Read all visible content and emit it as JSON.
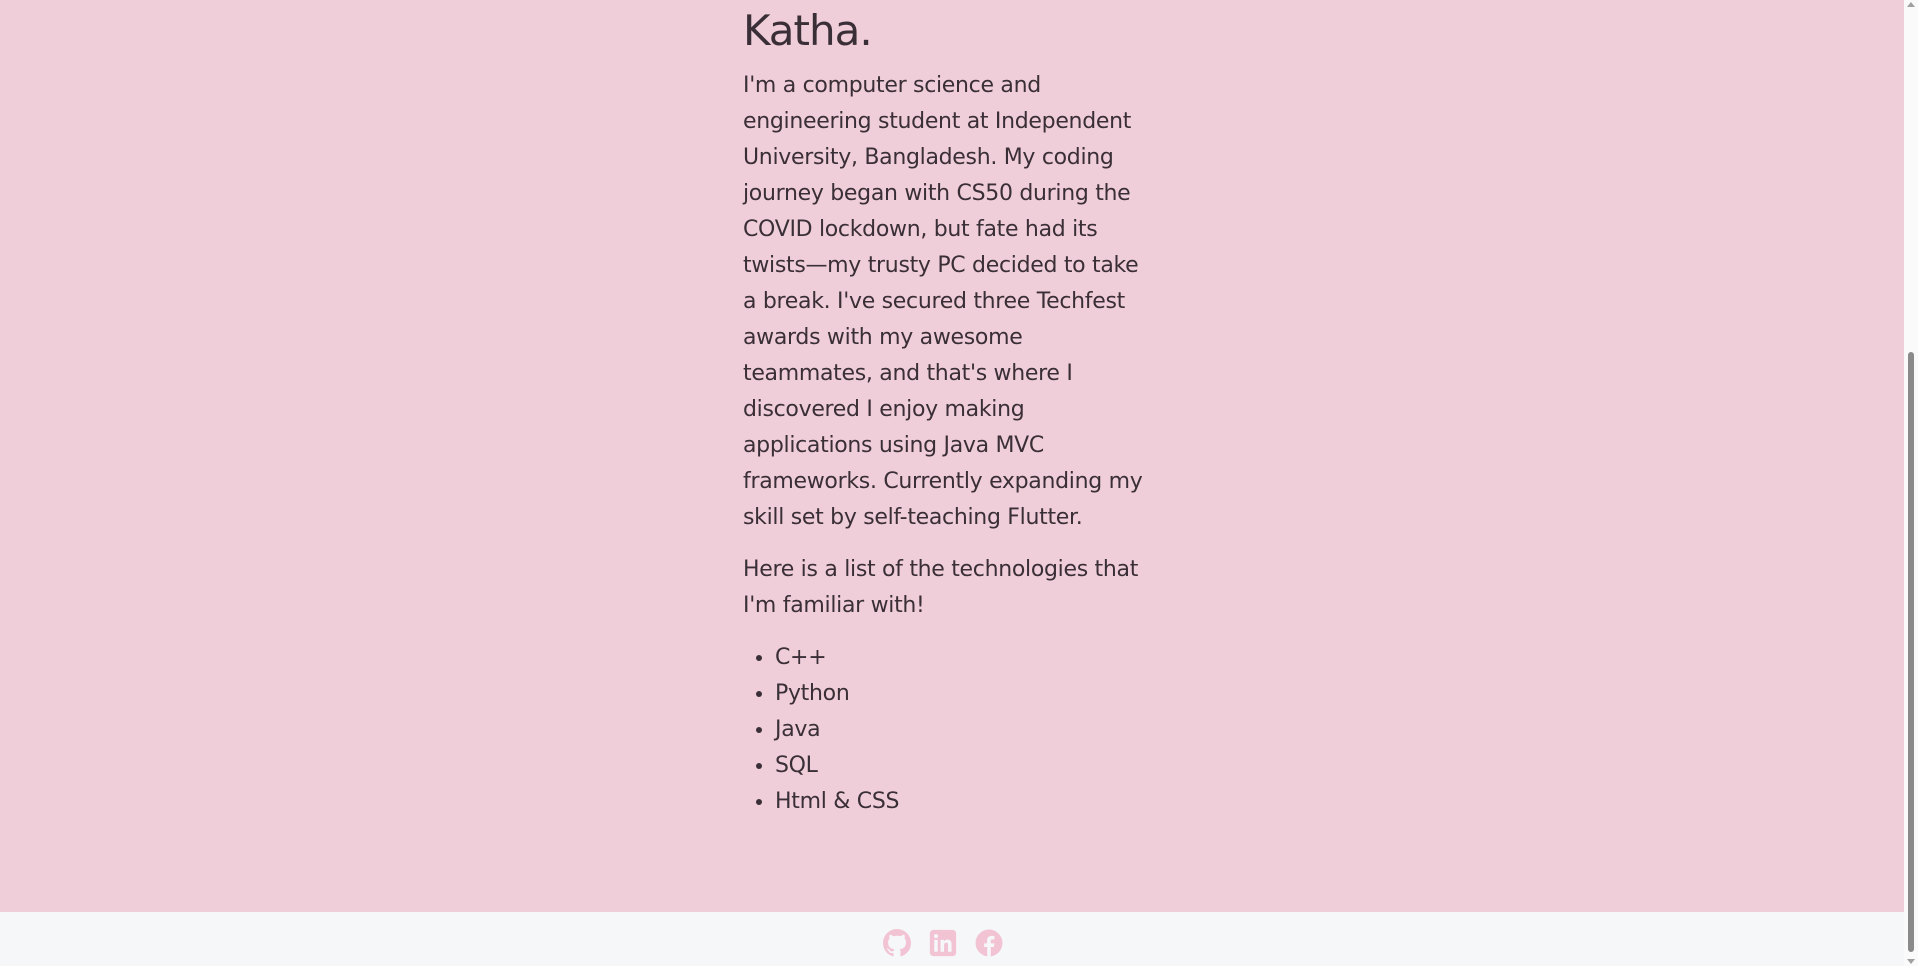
{
  "header": {
    "title": "Katha."
  },
  "about": {
    "bio": "I'm a computer science and engineering student at Independent University, Bangladesh. My coding journey began with CS50 during the COVID lockdown, but fate had its twists—my trusty PC decided to take a break. I've secured three Techfest awards with my awesome teammates, and that's where I discovered I enjoy making applications using Java MVC frameworks. Currently expanding my skill set by self-teaching Flutter.",
    "intro": "Here is a list of the technologies that I'm familiar with!",
    "technologies": [
      "C++",
      "Python",
      "Java",
      "SQL",
      "Html & CSS"
    ]
  },
  "footer": {
    "icons": [
      "github-icon",
      "linkedin-icon",
      "facebook-icon"
    ]
  },
  "colors": {
    "background": "#f0ced9",
    "text": "#3a2f36",
    "footer_background": "#f6f7f9",
    "icon": "#f2c4d3"
  }
}
